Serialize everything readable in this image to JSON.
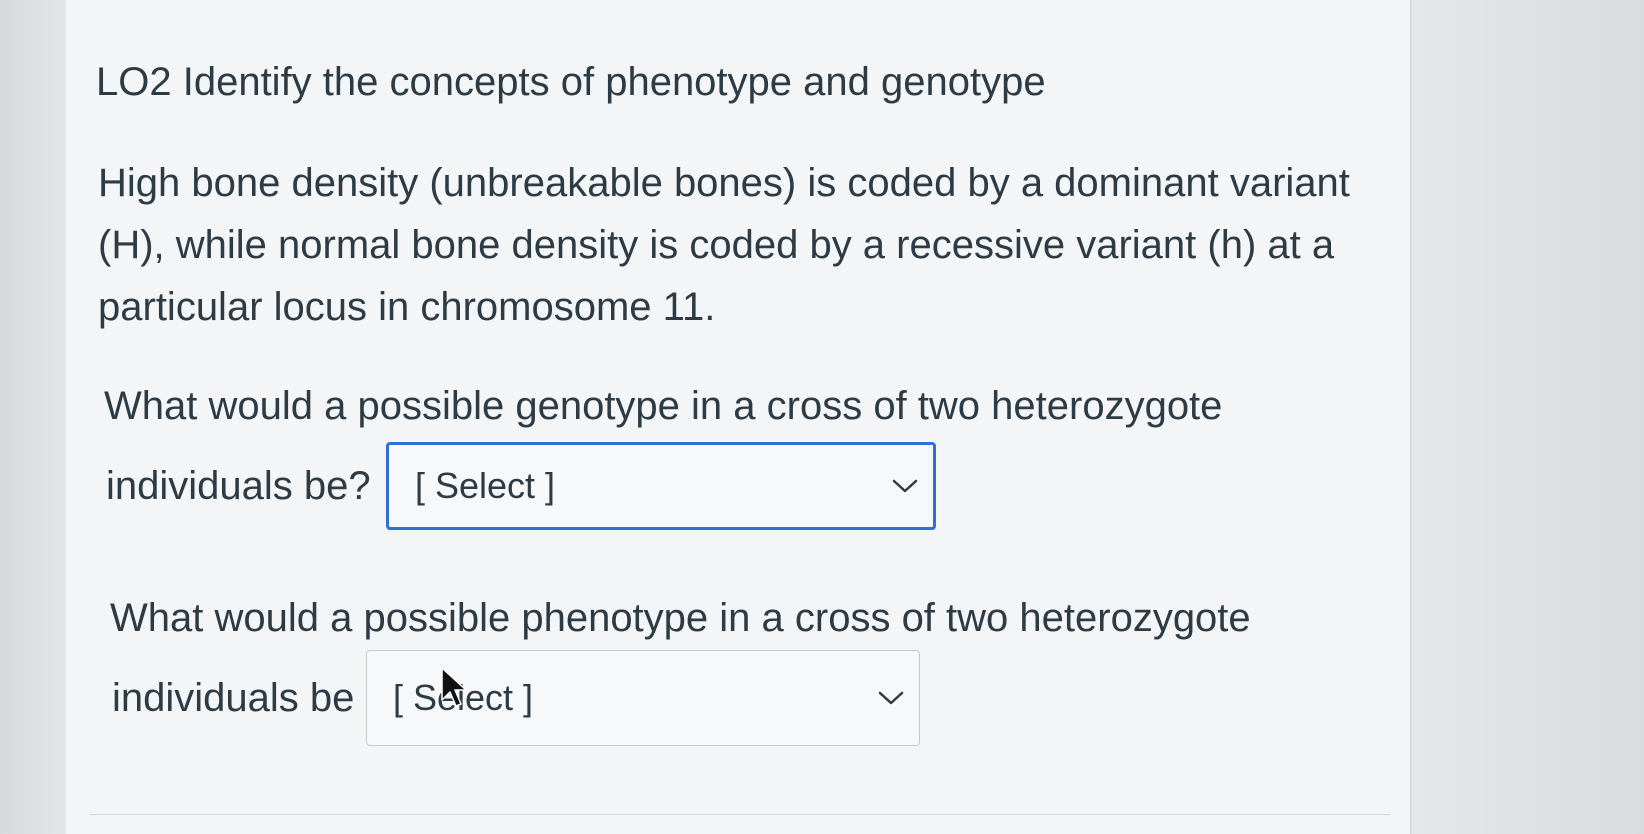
{
  "title": "LO2 Identify the concepts of phenotype and genotype",
  "question": {
    "description": "High bone density (unbreakable bones) is coded by a dominant variant (H), while normal bone density is coded by a recessive variant (h) at a particular locus in chromosome 11.",
    "q1": {
      "line1": "What would a possible genotype in a cross of two heterozygote",
      "line2": "individuals be?",
      "select_value": "[ Select ]"
    },
    "q2": {
      "line1": "What would a possible phenotype in a cross of two heterozygote",
      "line2": "individuals be",
      "select_value": "[ Select ]"
    }
  },
  "icons": {
    "dropdown": "chevron-down-icon",
    "pointer": "mouse-cursor-icon"
  },
  "colors": {
    "focus_border": "#2f6fd6",
    "text": "#2d3b45",
    "card_background": "#f4f5f6"
  }
}
